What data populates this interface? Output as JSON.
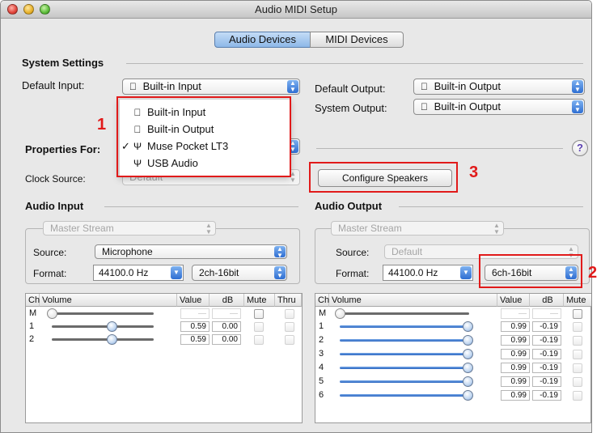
{
  "window": {
    "title": "Audio MIDI Setup"
  },
  "tabs": [
    {
      "label": "Audio Devices",
      "active": true
    },
    {
      "label": "MIDI Devices",
      "active": false
    }
  ],
  "system_settings": {
    "title": "System Settings",
    "default_input_label": "Default Input:",
    "default_input_value": "Built-in Input",
    "default_output_label": "Default Output:",
    "default_output_value": "Built-in Output",
    "system_output_label": "System Output:",
    "system_output_value": "Built-in Output"
  },
  "properties": {
    "label": "Properties For:",
    "clock_source_label": "Clock Source:",
    "clock_source_value": "Default",
    "configure_speakers": "Configure Speakers",
    "help": "?"
  },
  "input_menu": {
    "items": [
      {
        "label": "Built-in Input",
        "icon": "apple-icon",
        "checked": false
      },
      {
        "label": "Built-in Output",
        "icon": "apple-icon",
        "checked": false
      },
      {
        "label": "Muse Pocket LT3",
        "icon": "usb-icon",
        "checked": true
      },
      {
        "label": "USB Audio",
        "icon": "usb-icon",
        "checked": false
      }
    ]
  },
  "audio_input": {
    "title": "Audio Input",
    "master_stream": "Master Stream",
    "source_label": "Source:",
    "source_value": "Microphone",
    "format_label": "Format:",
    "rate": "44100.0 Hz",
    "bit_format": "2ch-16bit",
    "columns": [
      "Ch",
      "Volume",
      "Value",
      "dB",
      "Mute",
      "Thru"
    ],
    "rows": [
      {
        "ch": "M",
        "value": "—",
        "db": "—",
        "level": 0.0
      },
      {
        "ch": "1",
        "value": "0.59",
        "db": "0.00",
        "level": 0.59
      },
      {
        "ch": "2",
        "value": "0.59",
        "db": "0.00",
        "level": 0.59
      }
    ]
  },
  "audio_output": {
    "title": "Audio Output",
    "master_stream": "Master Stream",
    "source_label": "Source:",
    "source_value": "Default",
    "format_label": "Format:",
    "rate": "44100.0 Hz",
    "bit_format": "6ch-16bit",
    "columns": [
      "Ch",
      "Volume",
      "Value",
      "dB",
      "Mute"
    ],
    "rows": [
      {
        "ch": "M",
        "value": "—",
        "db": "—",
        "level": 0.0
      },
      {
        "ch": "1",
        "value": "0.99",
        "db": "-0.19",
        "level": 0.99
      },
      {
        "ch": "2",
        "value": "0.99",
        "db": "-0.19",
        "level": 0.99
      },
      {
        "ch": "3",
        "value": "0.99",
        "db": "-0.19",
        "level": 0.99
      },
      {
        "ch": "4",
        "value": "0.99",
        "db": "-0.19",
        "level": 0.99
      },
      {
        "ch": "5",
        "value": "0.99",
        "db": "-0.19",
        "level": 0.99
      },
      {
        "ch": "6",
        "value": "0.99",
        "db": "-0.19",
        "level": 0.99
      }
    ]
  },
  "annotations": [
    {
      "label": "1"
    },
    {
      "label": "2"
    },
    {
      "label": "3"
    }
  ],
  "colors": {
    "annotation": "#e11a1a",
    "accent": "#2e6ed2"
  }
}
